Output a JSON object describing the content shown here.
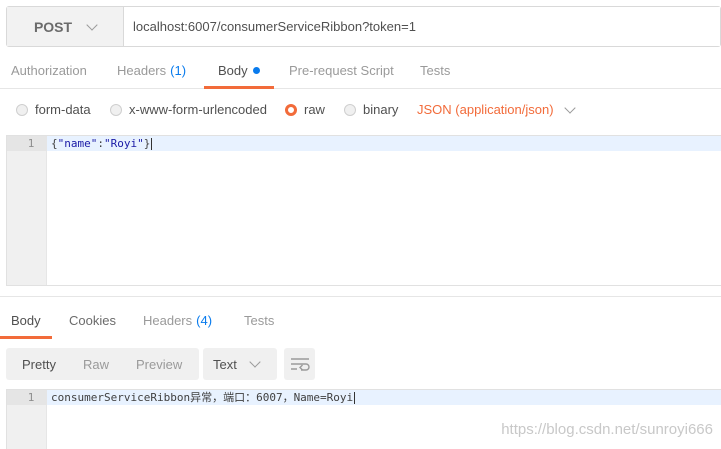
{
  "request": {
    "method": "POST",
    "url": "localhost:6007/consumerServiceRibbon?token=1"
  },
  "request_tabs": [
    {
      "label": "Authorization"
    },
    {
      "label": "Headers",
      "count": "(1)"
    },
    {
      "label": "Body"
    },
    {
      "label": "Pre-request Script"
    },
    {
      "label": "Tests"
    }
  ],
  "body_options": {
    "form_data": "form-data",
    "urlencoded": "x-www-form-urlencoded",
    "raw": "raw",
    "binary": "binary",
    "selected": "raw",
    "content_type": "JSON (application/json)"
  },
  "request_body": {
    "line_number": "1",
    "open": "{",
    "key": "\"name\"",
    "colon": ":",
    "value": "\"Royi\"",
    "close": "}"
  },
  "response_tabs": [
    {
      "label": "Body"
    },
    {
      "label": "Cookies"
    },
    {
      "label": "Headers",
      "count": "(4)"
    },
    {
      "label": "Tests"
    }
  ],
  "response_toolbar": {
    "pretty": "Pretty",
    "raw": "Raw",
    "preview": "Preview",
    "format": "Text"
  },
  "response_body": {
    "line_number": "1",
    "text": "consumerServiceRibbon异常，端口：6007，Name=Royi"
  },
  "watermark": "https://blog.csdn.net/sunroyi666",
  "colors": {
    "accent": "#f26b3a",
    "count_blue": "#097bed"
  },
  "icons": {
    "method_dropdown": "chevron-down-icon",
    "content_type_dropdown": "chevron-down-icon",
    "format_dropdown": "chevron-down-icon",
    "wrap": "wrap-lines-icon"
  }
}
